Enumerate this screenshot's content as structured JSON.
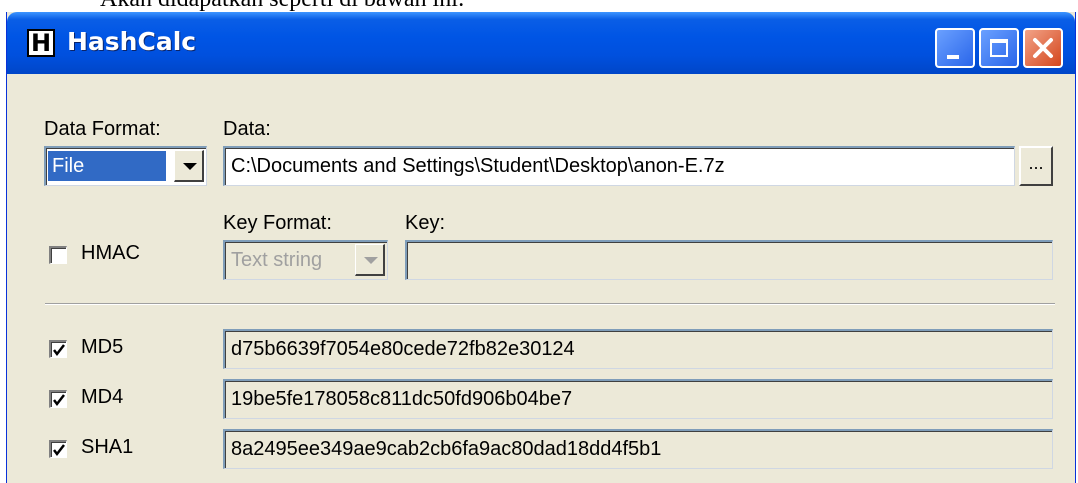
{
  "document_text": "Akan didapatkan seperti di bawah ini:",
  "window": {
    "title": "HashCalc",
    "icon_letter": "H"
  },
  "data_format": {
    "label": "Data Format:",
    "selected": "File"
  },
  "data": {
    "label": "Data:",
    "value": "C:\\Documents and Settings\\Student\\Desktop\\anon-E.7z",
    "browse_label": "..."
  },
  "hmac": {
    "label": "HMAC",
    "checked": false
  },
  "key_format": {
    "label": "Key Format:",
    "selected": "Text string"
  },
  "key": {
    "label": "Key:",
    "value": ""
  },
  "hashes": [
    {
      "label": "MD5",
      "checked": true,
      "value": "d75b6639f7054e80cede72fb82e30124"
    },
    {
      "label": "MD4",
      "checked": true,
      "value": "19be5fe178058c811dc50fd906b04be7"
    },
    {
      "label": "SHA1",
      "checked": true,
      "value": "8a2495ee349ae9cab2cb6fa9ac80dad18dd4f5b1"
    }
  ]
}
